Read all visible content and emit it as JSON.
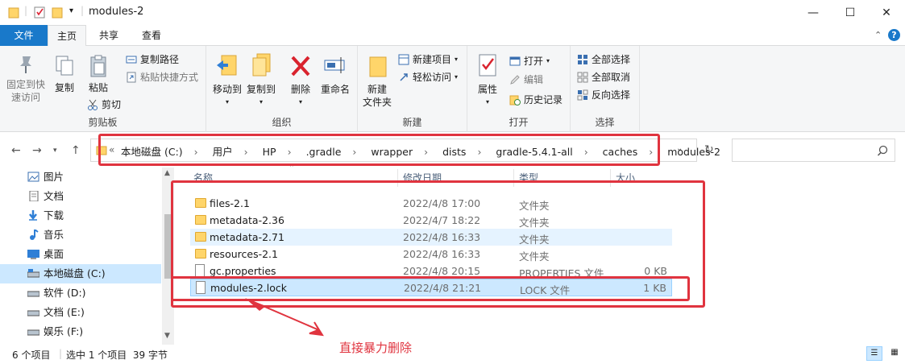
{
  "window": {
    "title": "modules-2",
    "controls": {
      "minimize": "—",
      "maximize": "☐",
      "close": "✕"
    }
  },
  "ribbon_tabs": [
    "文件",
    "主页",
    "共享",
    "查看"
  ],
  "ribbon": {
    "clipboard": {
      "label": "剪贴板",
      "pin": "固定到快\n速访问",
      "copy": "复制",
      "paste": "粘贴",
      "copy_path": "复制路径",
      "paste_shortcut": "粘贴快捷方式",
      "cut": "剪切"
    },
    "organize": {
      "label": "组织",
      "move_to": "移动到",
      "copy_to": "复制到",
      "delete": "删除",
      "rename": "重命名"
    },
    "new": {
      "label": "新建",
      "new_folder": "新建\n文件夹",
      "new_item": "新建项目",
      "easy_access": "轻松访问"
    },
    "open": {
      "label": "打开",
      "properties": "属性",
      "open": "打开",
      "edit": "编辑",
      "history": "历史记录"
    },
    "select": {
      "label": "选择",
      "select_all": "全部选择",
      "select_none": "全部取消",
      "invert": "反向选择"
    }
  },
  "breadcrumbs": [
    "本地磁盘 (C:)",
    "用户",
    "HP",
    ".gradle",
    "wrapper",
    "dists",
    "gradle-5.4.1-all",
    "caches",
    "modules-2"
  ],
  "nav_pane": [
    {
      "label": "图片",
      "icon": "pictures-icon"
    },
    {
      "label": "文档",
      "icon": "documents-icon"
    },
    {
      "label": "下载",
      "icon": "download-icon"
    },
    {
      "label": "音乐",
      "icon": "music-icon"
    },
    {
      "label": "桌面",
      "icon": "desktop-icon"
    },
    {
      "label": "本地磁盘 (C:)",
      "icon": "drive-icon"
    },
    {
      "label": "软件 (D:)",
      "icon": "drive-icon"
    },
    {
      "label": "文档 (E:)",
      "icon": "drive-icon"
    },
    {
      "label": "娱乐 (F:)",
      "icon": "drive-icon"
    }
  ],
  "columns": {
    "name": "名称",
    "date": "修改日期",
    "type": "类型",
    "size": "大小"
  },
  "files": [
    {
      "name": "files-2.1",
      "date": "2022/4/8 17:00",
      "type": "文件夹",
      "size": "",
      "kind": "folder"
    },
    {
      "name": "metadata-2.36",
      "date": "2022/4/7 18:22",
      "type": "文件夹",
      "size": "",
      "kind": "folder"
    },
    {
      "name": "metadata-2.71",
      "date": "2022/4/8 16:33",
      "type": "文件夹",
      "size": "",
      "kind": "folder"
    },
    {
      "name": "resources-2.1",
      "date": "2022/4/8 16:33",
      "type": "文件夹",
      "size": "",
      "kind": "folder"
    },
    {
      "name": "gc.properties",
      "date": "2022/4/8 20:15",
      "type": "PROPERTIES 文件",
      "size": "0 KB",
      "kind": "file"
    },
    {
      "name": "modules-2.lock",
      "date": "2022/4/8 21:21",
      "type": "LOCK 文件",
      "size": "1 KB",
      "kind": "file"
    }
  ],
  "status": {
    "count": "6 个项目",
    "selection": "选中 1 个项目  39 字节"
  },
  "annotation": {
    "text": "直接暴力删除",
    "color": "#e0343f"
  },
  "colors": {
    "accent": "#1979ca",
    "selected": "#cce8ff",
    "hover": "#e5f3ff"
  }
}
